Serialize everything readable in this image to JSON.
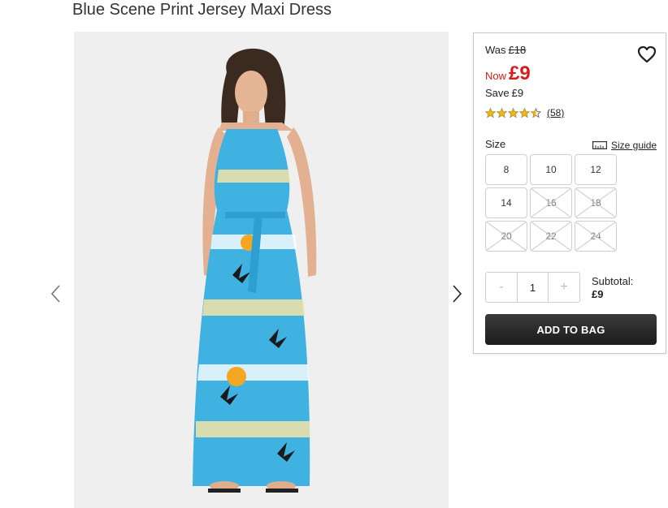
{
  "product": {
    "title": "Blue Scene Print Jersey Maxi Dress"
  },
  "price": {
    "was_label": "Was",
    "was_value": "£18",
    "now_label": "Now",
    "now_value": "£9",
    "save_label": "Save",
    "save_value": "£9"
  },
  "rating": {
    "value": 4.5,
    "max": 5,
    "count_label": "(58)"
  },
  "sizes": {
    "label": "Size",
    "guide_label": "Size guide",
    "options": [
      {
        "label": "8",
        "available": true
      },
      {
        "label": "10",
        "available": true
      },
      {
        "label": "12",
        "available": true
      },
      {
        "label": "14",
        "available": true
      },
      {
        "label": "16",
        "available": false
      },
      {
        "label": "18",
        "available": false
      },
      {
        "label": "20",
        "available": false
      },
      {
        "label": "22",
        "available": false
      },
      {
        "label": "24",
        "available": false
      }
    ]
  },
  "quantity": {
    "minus": "-",
    "value": "1",
    "plus": "+"
  },
  "subtotal": {
    "label": "Subtotal:",
    "value": "£9"
  },
  "actions": {
    "add_to_bag": "ADD TO BAG"
  },
  "icons": {
    "prev": "chevron-left-icon",
    "next": "chevron-right-icon",
    "favourite": "heart-icon",
    "size_guide": "ruler-icon",
    "star": "star-icon"
  },
  "colors": {
    "price_red": "#d71c1c",
    "star": "#f2b705",
    "button": "#262626",
    "dress_blue": "#3fb2e2"
  }
}
